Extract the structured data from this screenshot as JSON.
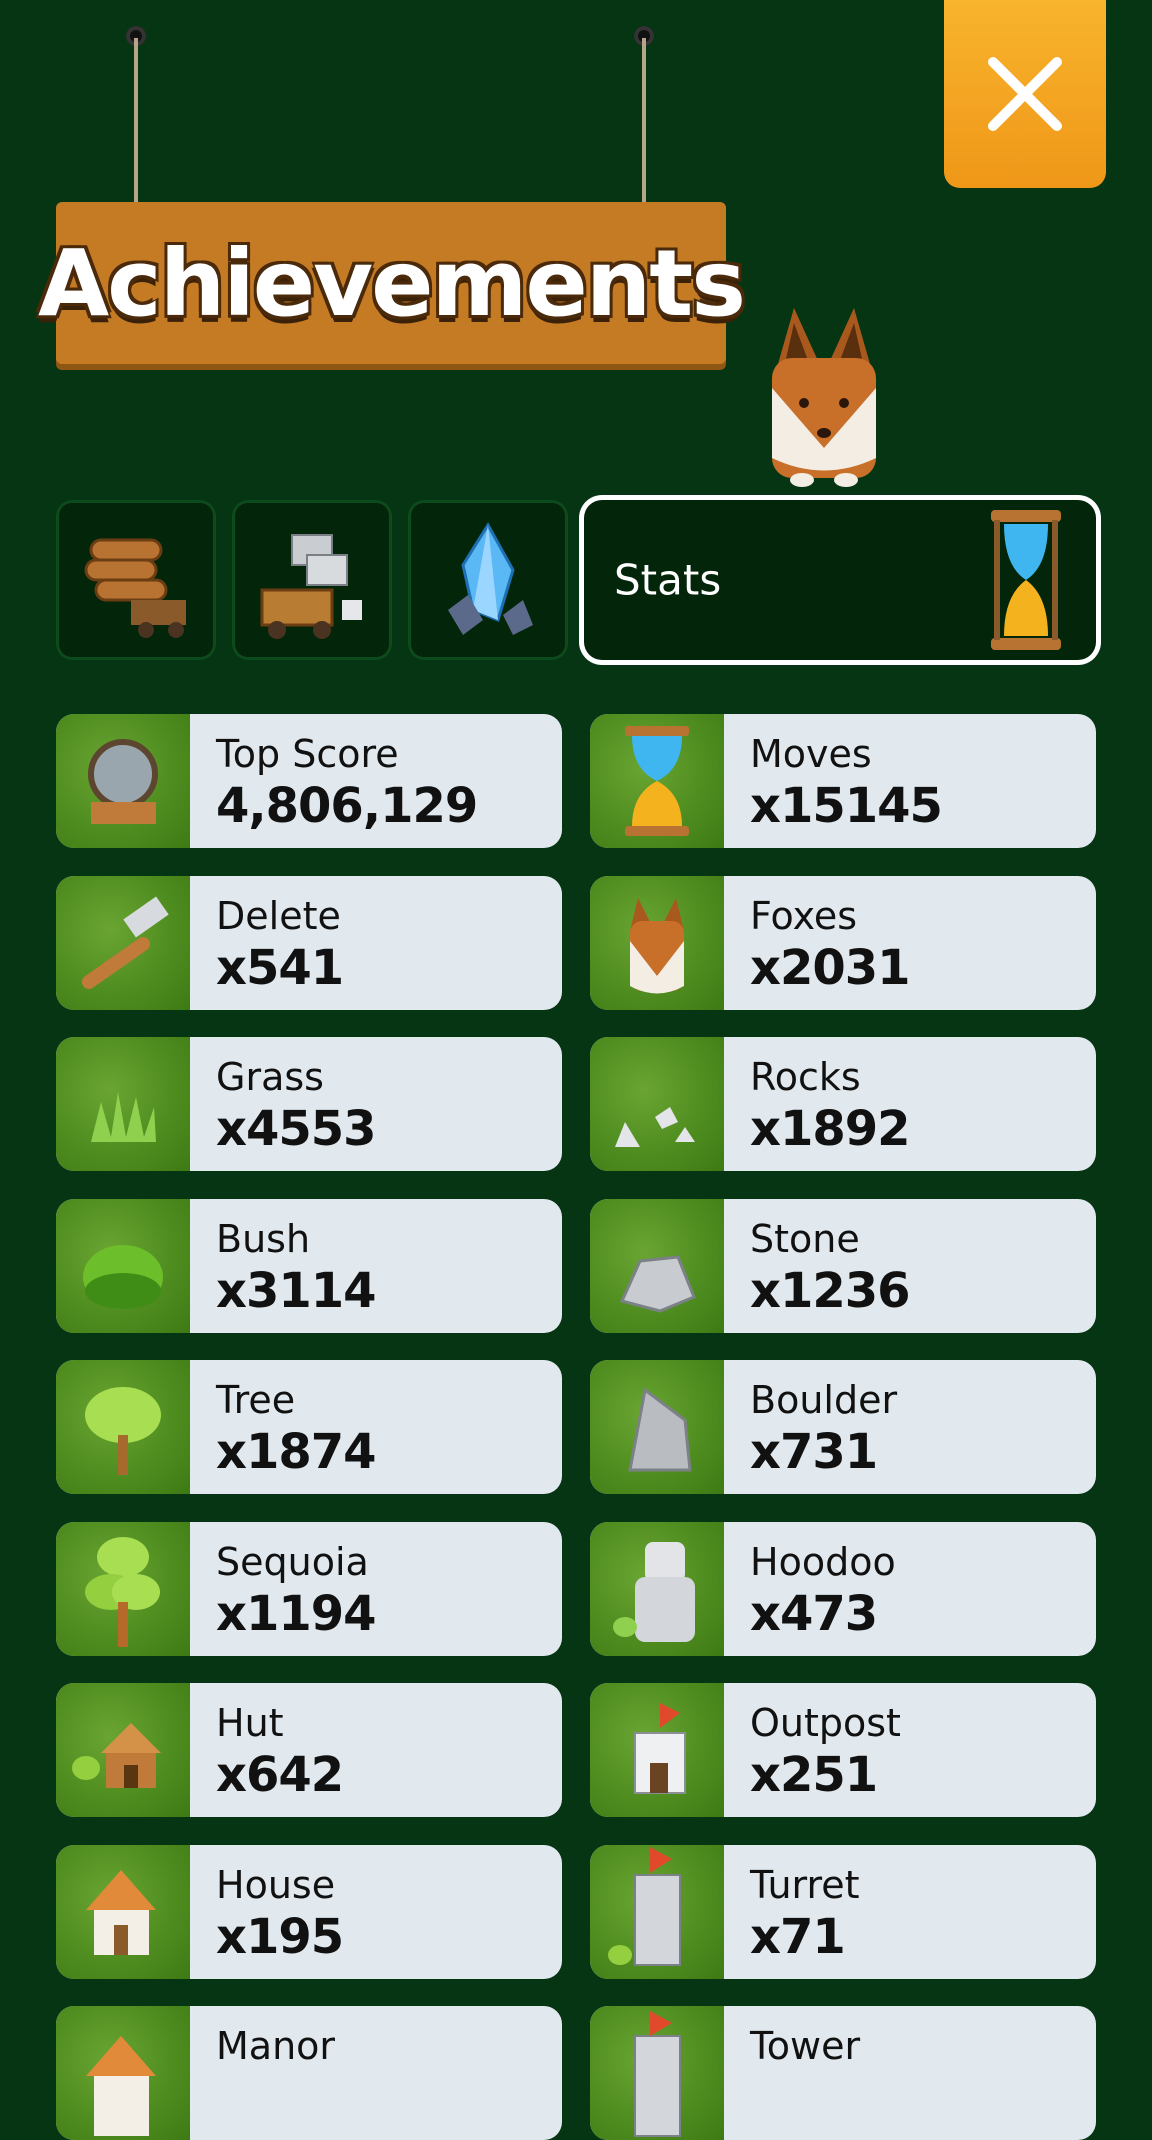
{
  "header": {
    "title": "Achievements"
  },
  "close": {
    "icon": "close-icon"
  },
  "tabs": [
    {
      "icon": "logs-cart-icon",
      "label": ""
    },
    {
      "icon": "stone-blocks-cart-icon",
      "label": ""
    },
    {
      "icon": "crystal-icon",
      "label": ""
    },
    {
      "icon": "hourglass-icon",
      "label": "Stats",
      "active": true
    }
  ],
  "stats": [
    {
      "label": "Top Score",
      "value": "4,806,129",
      "icon": "cannon-icon"
    },
    {
      "label": "Moves",
      "value": "x15145",
      "icon": "hourglass-icon"
    },
    {
      "label": "Delete",
      "value": "x541",
      "icon": "hammer-icon"
    },
    {
      "label": "Foxes",
      "value": "x2031",
      "icon": "fox-icon"
    },
    {
      "label": "Grass",
      "value": "x4553",
      "icon": "grass-icon"
    },
    {
      "label": "Rocks",
      "value": "x1892",
      "icon": "rocks-icon"
    },
    {
      "label": "Bush",
      "value": "x3114",
      "icon": "bush-icon"
    },
    {
      "label": "Stone",
      "value": "x1236",
      "icon": "stone-icon"
    },
    {
      "label": "Tree",
      "value": "x1874",
      "icon": "tree-icon"
    },
    {
      "label": "Boulder",
      "value": "x731",
      "icon": "boulder-icon"
    },
    {
      "label": "Sequoia",
      "value": "x1194",
      "icon": "sequoia-icon"
    },
    {
      "label": "Hoodoo",
      "value": "x473",
      "icon": "hoodoo-icon"
    },
    {
      "label": "Hut",
      "value": "x642",
      "icon": "hut-icon"
    },
    {
      "label": "Outpost",
      "value": "x251",
      "icon": "outpost-icon"
    },
    {
      "label": "House",
      "value": "x195",
      "icon": "house-icon"
    },
    {
      "label": "Turret",
      "value": "x71",
      "icon": "turret-icon"
    },
    {
      "label": "Manor",
      "value": "",
      "icon": "manor-icon"
    },
    {
      "label": "Tower",
      "value": "",
      "icon": "tower-icon"
    }
  ],
  "colors": {
    "background": "#053512",
    "sign": "#c47b23",
    "close": "#f4a623",
    "card": "#e1e9ee"
  }
}
